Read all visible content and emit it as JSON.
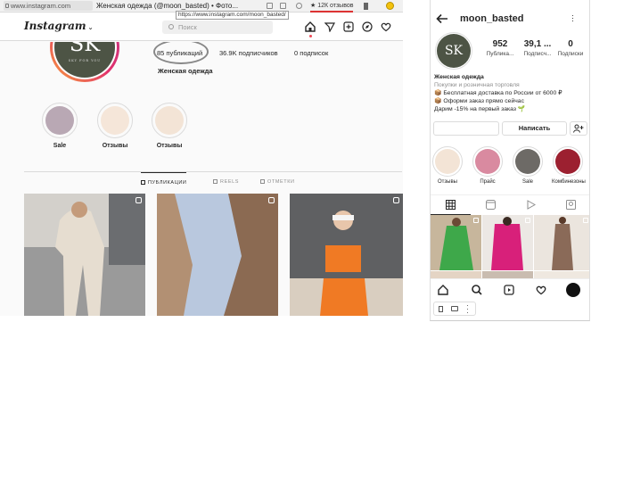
{
  "browser": {
    "url": "www.instagram.com",
    "tab_title": "Женская одежда (@moon_basted) • Фото...",
    "tooltip": "https://www.instagram.com/moon_basted/",
    "reviews_label": "★ 12К отзывов"
  },
  "desktop": {
    "logo_text": "Instagram",
    "search_placeholder": "Поиск",
    "avatar_text": "SK",
    "avatar_subtext": "SKY FOR YOU",
    "stats": {
      "posts": "85 публикаций",
      "followers": "36.9K подписчиков",
      "following": "0 подписок"
    },
    "bio_name": "Женская одежда",
    "highlights": [
      {
        "label": "Sale",
        "color": "#b9a8b4"
      },
      {
        "label": "Отзывы",
        "color": "#f5e6d9"
      },
      {
        "label": "Отзывы",
        "color": "#f3e4d6"
      }
    ],
    "tabs": [
      "ПУБЛИКАЦИИ",
      "REELS",
      "ОТМЕТКИ"
    ],
    "posts": [
      {
        "color": "#d8d2c9",
        "name": "beige-tracksuit-post"
      },
      {
        "color": "#b6c6dc",
        "name": "blue-tracksuit-post"
      },
      {
        "color": "#f07a24",
        "name": "orange-set-post"
      }
    ]
  },
  "mobile": {
    "username": "moon_basted",
    "avatar_text": "SK",
    "stats": [
      {
        "n": "952",
        "l": "Публика..."
      },
      {
        "n": "39,1 ...",
        "l": "Подписч..."
      },
      {
        "n": "0",
        "l": "Подписки"
      }
    ],
    "bio": {
      "name": "Женская одежда",
      "category": "Покупки и розничная торговля",
      "line1": "📦 Бесплатная доставка по России от 6000 ₽",
      "line2": "📦 Оформи заказ прямо сейчас",
      "line3": "Дарим -15% на первый заказ 🌱"
    },
    "message_button": "Написать",
    "highlights": [
      {
        "label": "Отзывы",
        "color": "#f3e4d6"
      },
      {
        "label": "Прайс",
        "color": "#d98aa0"
      },
      {
        "label": "Sale",
        "color": "#6d6a66"
      },
      {
        "label": "Комбинезоны",
        "color": "#9c2030"
      }
    ],
    "posts": [
      {
        "color": "#3ea84a",
        "name": "green-dress-post"
      },
      {
        "color": "#d8207a",
        "name": "pink-suit-post"
      },
      {
        "color": "#8a6a58",
        "name": "brown-dress-post"
      },
      {
        "color": "#e4d4c4",
        "name": "light-post"
      },
      {
        "color": "#c9bcb0",
        "name": "beige-post"
      },
      {
        "color": "#efe8e0",
        "name": "white-post"
      }
    ]
  }
}
